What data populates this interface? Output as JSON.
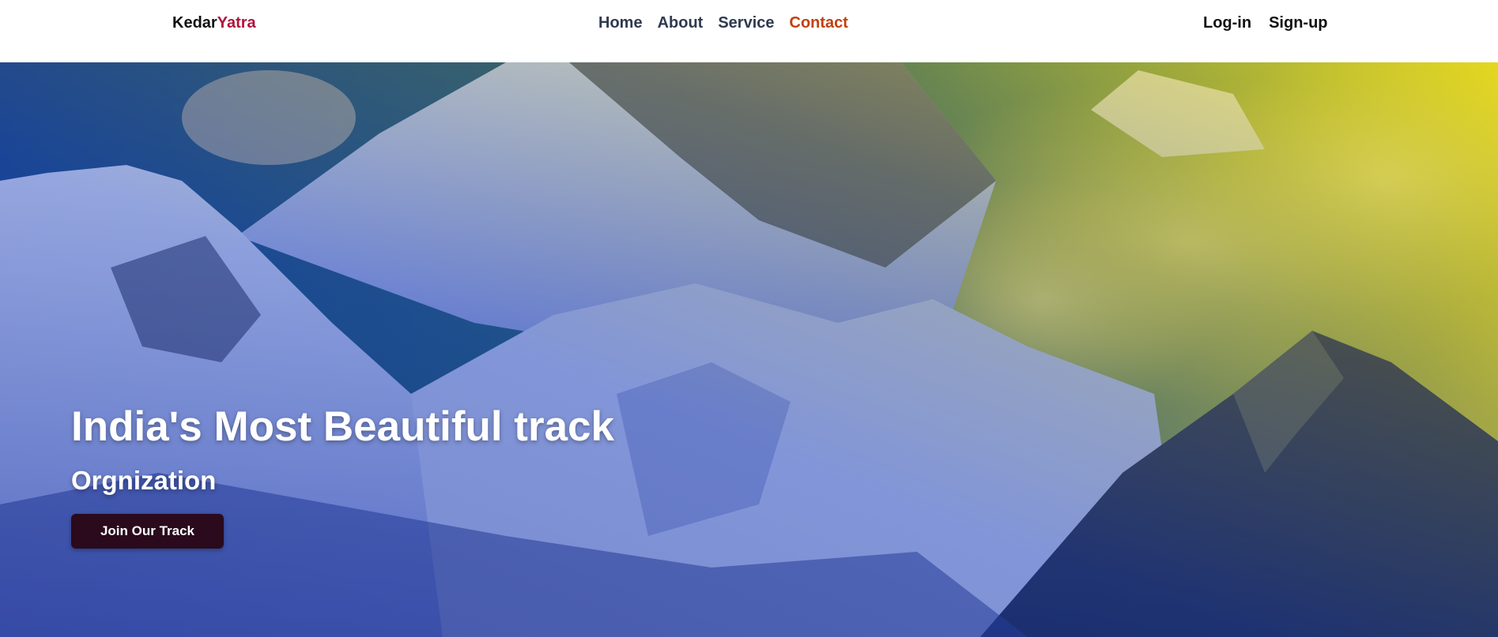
{
  "brand": {
    "part1": "Kedar",
    "part2": "Yatra",
    "accent_color": "#b1123c"
  },
  "nav": {
    "items": [
      {
        "label": "Home"
      },
      {
        "label": "About"
      },
      {
        "label": "Service"
      },
      {
        "label": "Contact",
        "active": true
      }
    ],
    "active_color": "#c2410c"
  },
  "auth": {
    "login_label": "Log-in",
    "signup_label": "Sign-up"
  },
  "hero": {
    "title": "India's Most Beautiful track",
    "subtitle": "Orgnization",
    "cta_label": "Join Our Track",
    "background": "mountain-range-image",
    "gradient_colors": [
      "#1230a0",
      "#f2e21a"
    ]
  }
}
